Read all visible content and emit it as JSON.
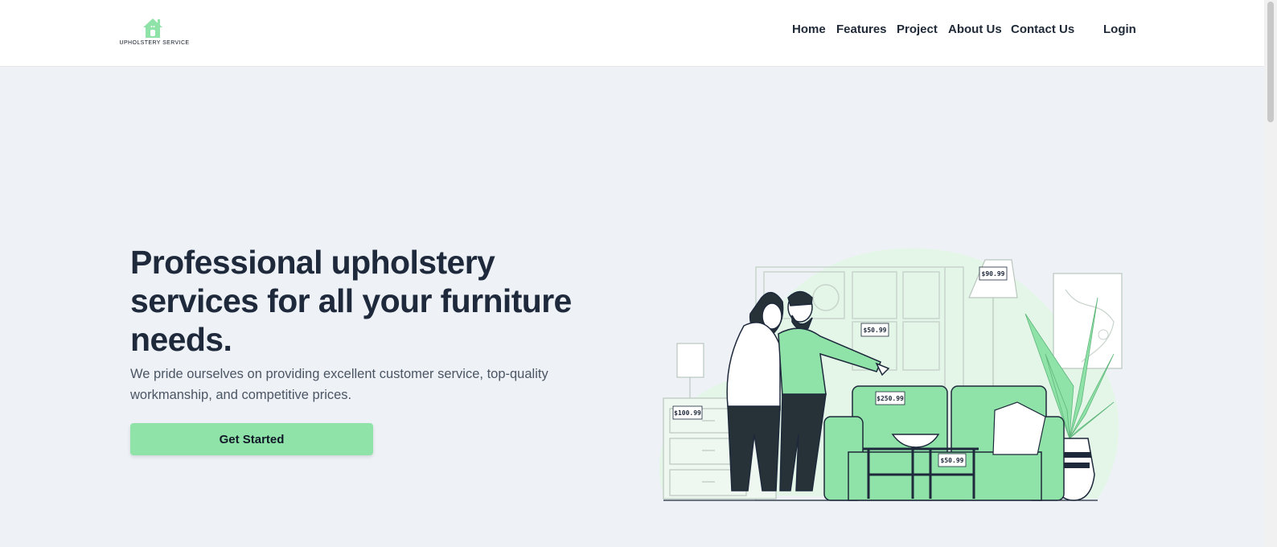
{
  "brand": {
    "logo_text": "UPHOLSTERY SERVICE",
    "accent_color": "#8fe3a8"
  },
  "nav": {
    "items": [
      {
        "label": "Home"
      },
      {
        "label": "Features"
      },
      {
        "label": "Project"
      },
      {
        "label": "About Us"
      },
      {
        "label": "Contact Us"
      }
    ],
    "login_label": "Login"
  },
  "hero": {
    "title": "Professional upholstery services for all your furniture needs.",
    "subtitle": "We pride ourselves on providing excellent customer service, top-quality workmanship, and competitive prices.",
    "cta_label": "Get Started"
  },
  "illustration": {
    "price_tags": [
      "$90.99",
      "$50.99",
      "$250.99",
      "$100.99",
      "$50.99"
    ]
  }
}
